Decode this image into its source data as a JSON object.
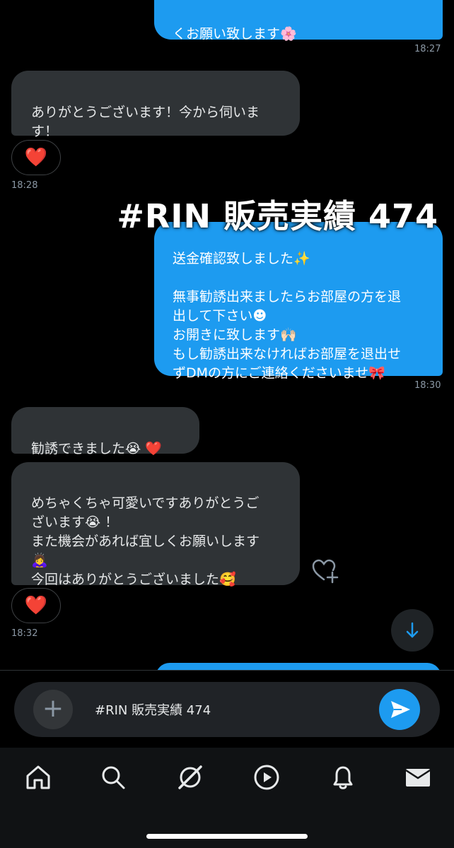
{
  "messages": {
    "m1": {
      "text": "くお願い致します🌸",
      "time": "18:27"
    },
    "m2": {
      "text": "ありがとうございます！今から伺いま\nす！",
      "reaction": "❤️",
      "time": "18:28"
    },
    "m3": {
      "text": "送金確認致しました✨\n\n無事勧誘出来ましたらお部屋の方を退\n出して下さい☻\nお開きに致します🙌🏻\nもし勧誘出来なければお部屋を退出せ\nずDMの方にご連絡くださいませ🎀",
      "time": "18:30"
    },
    "m4": {
      "text": "勧誘できました😭 ❤️"
    },
    "m5": {
      "text": "めちゃくちゃ可愛いですありがとうご\nざいます😭 ！\nまた機会があれば宜しくお願いします\n🙇‍♀️\n今回はありがとうございました🥰",
      "reaction": "❤️",
      "time": "18:32"
    }
  },
  "overlay": {
    "text": "#RIN 販売実績 474"
  },
  "composer": {
    "value": "#RIN 販売実績 474",
    "plus": "+"
  },
  "nav": {
    "items": [
      "home-icon",
      "search-icon",
      "grok-icon",
      "video-icon",
      "notifications-icon",
      "messages-icon"
    ]
  },
  "colors": {
    "accent": "#1d9bf0",
    "bubble_in": "#2f3336",
    "background": "#000000"
  }
}
